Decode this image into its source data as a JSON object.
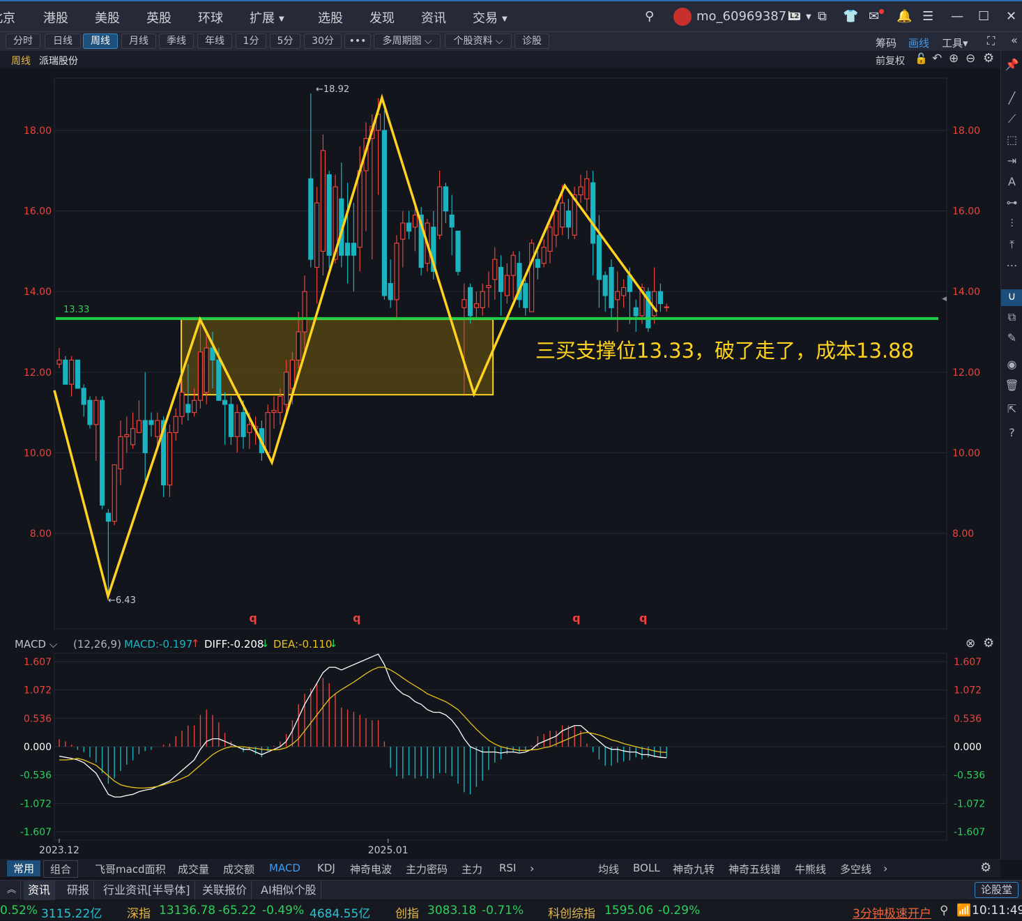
{
  "colors": {
    "up": "#e8453c",
    "down": "#1ab3c0",
    "drawing": "#ffd21f",
    "support": "#22cc44",
    "zone_fill": "#5a4a12",
    "grid": "#262a36"
  },
  "topbar": {
    "nav": [
      {
        "label": "北京"
      },
      {
        "label": "港股"
      },
      {
        "label": "美股"
      },
      {
        "label": "英股"
      },
      {
        "label": "环球"
      },
      {
        "label": "扩展",
        "dropdown": true
      },
      {
        "label": "选股"
      },
      {
        "label": "发现"
      },
      {
        "label": "资讯"
      },
      {
        "label": "交易",
        "dropdown": true
      }
    ],
    "username": "mo_60969387!",
    "level_badge": "L2",
    "icons": [
      "search-icon",
      "avatar",
      "dropdown-icon",
      "external-window-icon",
      "shirt-icon",
      "mail-icon",
      "bell-icon",
      "list-icon",
      "minimize-icon",
      "maximize-icon",
      "close-icon"
    ]
  },
  "toolbar": {
    "periods": [
      "分时",
      "日线",
      "周线",
      "月线",
      "季线",
      "年线",
      "1分",
      "5分",
      "30分",
      "•••",
      "多周期图 ⌵",
      "个股资料 ⌵",
      "诊股"
    ],
    "active": "周线",
    "right": {
      "chips": "筹码",
      "draw": "画线",
      "tools": "工具▾"
    }
  },
  "title": {
    "period": "周线",
    "stock": "派瑞股份",
    "adjust": "前复权"
  },
  "chart_data": [
    {
      "type": "candlestick",
      "title": "派瑞股份",
      "period": "周线",
      "yticks": [
        "18.00",
        "16.00",
        "14.00",
        "12.00",
        "10.00",
        "8.00"
      ],
      "ylim": [
        5.55,
        19.2
      ],
      "xticks": [
        {
          "label": "2023.12",
          "index": 0
        },
        {
          "label": "2025.01",
          "index": 53.6
        }
      ],
      "max_label": "←18.92",
      "min_label": "←6.43",
      "fields": [
        "open",
        "close",
        "high",
        "low"
      ],
      "candles": [
        [
          12.2,
          12.3,
          12.6,
          12.1
        ],
        [
          12.3,
          11.7,
          12.4,
          11.7
        ],
        [
          11.7,
          12.3,
          12.4,
          11.4
        ],
        [
          12.3,
          11.6,
          12.3,
          11.6
        ],
        [
          11.6,
          11.2,
          11.7,
          10.9
        ],
        [
          11.3,
          10.7,
          11.4,
          10.6
        ],
        [
          10.7,
          11.3,
          11.4,
          9.8
        ],
        [
          11.3,
          8.7,
          11.4,
          8.6
        ],
        [
          8.5,
          8.3,
          8.6,
          6.43
        ],
        [
          8.3,
          9.7,
          9.7,
          8.2
        ],
        [
          9.6,
          10.4,
          10.8,
          9.2
        ],
        [
          10.4,
          10.45,
          10.9,
          10.0
        ],
        [
          10.2,
          10.6,
          11.0,
          10.1
        ],
        [
          10.5,
          10.8,
          11.3,
          10.5
        ],
        [
          10.8,
          10.0,
          12.0,
          9.3
        ],
        [
          10.8,
          10.7,
          11.0,
          10.4
        ],
        [
          10.4,
          10.8,
          11.0,
          10.2
        ],
        [
          10.8,
          9.2,
          10.9,
          8.9
        ],
        [
          9.2,
          10.5,
          10.7,
          8.9
        ],
        [
          10.5,
          10.9,
          11.1,
          10.3
        ],
        [
          10.9,
          11.5,
          11.8,
          10.7
        ],
        [
          11.2,
          11.0,
          12.2,
          10.8
        ],
        [
          11.0,
          11.3,
          11.6,
          10.9
        ],
        [
          11.3,
          12.5,
          13.33,
          11.1
        ],
        [
          11.5,
          12.6,
          13.0,
          11.2
        ],
        [
          12.6,
          12.3,
          13.0,
          11.6
        ],
        [
          12.3,
          11.3,
          12.6,
          11.3
        ],
        [
          11.3,
          11.2,
          11.5,
          10.2
        ],
        [
          11.2,
          10.4,
          11.4,
          10.2
        ],
        [
          10.4,
          11.0,
          11.2,
          10.0
        ],
        [
          11.0,
          10.4,
          11.3,
          10.1
        ],
        [
          10.5,
          10.7,
          11.0,
          10.1
        ],
        [
          10.6,
          10.65,
          10.9,
          10.2
        ],
        [
          10.6,
          10.0,
          10.8,
          9.8
        ],
        [
          10.0,
          11.0,
          11.2,
          9.9
        ],
        [
          11.0,
          11.05,
          11.4,
          10.6
        ],
        [
          11.0,
          11.4,
          11.6,
          10.7
        ],
        [
          11.2,
          12.0,
          12.3,
          10.9
        ],
        [
          11.6,
          12.3,
          12.5,
          11.2
        ],
        [
          12.3,
          13.0,
          13.5,
          12.1
        ],
        [
          13.0,
          14.0,
          14.4,
          12.5
        ],
        [
          16.8,
          14.8,
          18.92,
          14.6
        ],
        [
          14.6,
          16.2,
          16.6,
          13.7
        ],
        [
          15.0,
          17.5,
          17.9,
          14.4
        ],
        [
          16.9,
          14.9,
          17.0,
          14.6
        ],
        [
          14.8,
          16.6,
          16.9,
          14.7
        ],
        [
          16.3,
          14.9,
          17.2,
          14.6
        ],
        [
          15.2,
          14.9,
          16.7,
          14.2
        ],
        [
          15.2,
          14.9,
          16.2,
          14.0
        ],
        [
          15.1,
          17.0,
          17.6,
          14.5
        ],
        [
          17.0,
          17.8,
          18.2,
          15.5
        ],
        [
          17.8,
          18.1,
          18.4,
          14.8
        ],
        [
          18.0,
          18.4,
          18.8,
          16.4
        ],
        [
          18.0,
          13.9,
          18.5,
          13.8
        ],
        [
          14.2,
          13.8,
          14.8,
          13.6
        ],
        [
          13.8,
          15.2,
          15.4,
          13.3
        ],
        [
          15.3,
          15.7,
          16.0,
          14.6
        ],
        [
          15.7,
          15.5,
          16.0,
          15.3
        ],
        [
          15.6,
          15.9,
          16.2,
          15.0
        ],
        [
          15.9,
          14.6,
          16.1,
          14.4
        ],
        [
          14.7,
          15.7,
          15.8,
          14.5
        ],
        [
          15.6,
          14.5,
          16.0,
          14.3
        ],
        [
          15.4,
          16.6,
          17.0,
          15.3
        ],
        [
          16.6,
          16.0,
          16.7,
          15.7
        ],
        [
          15.9,
          15.6,
          16.4,
          14.9
        ],
        [
          15.5,
          14.5,
          15.5,
          14.4
        ],
        [
          13.6,
          13.8,
          14.2,
          11.45
        ],
        [
          14.1,
          13.4,
          14.2,
          13.2
        ],
        [
          13.6,
          13.7,
          14.0,
          13.3
        ],
        [
          13.6,
          14.0,
          14.2,
          13.4
        ],
        [
          14.1,
          14.15,
          14.5,
          13.6
        ],
        [
          14.3,
          14.8,
          15.1,
          13.8
        ],
        [
          14.6,
          14.0,
          14.9,
          13.4
        ],
        [
          13.9,
          14.4,
          14.7,
          13.7
        ],
        [
          14.4,
          14.9,
          15.0,
          13.8
        ],
        [
          14.7,
          13.8,
          15.0,
          13.6
        ],
        [
          14.2,
          13.6,
          14.3,
          13.4
        ],
        [
          13.5,
          15.2,
          15.3,
          13.5
        ],
        [
          14.8,
          14.6,
          15.0,
          14.3
        ],
        [
          14.7,
          15.1,
          15.3,
          14.6
        ],
        [
          15.0,
          15.6,
          15.7,
          14.7
        ],
        [
          15.4,
          16.0,
          16.3,
          15.1
        ],
        [
          15.6,
          16.2,
          16.65,
          15.4
        ],
        [
          16.0,
          15.6,
          16.3,
          15.3
        ],
        [
          15.4,
          16.4,
          16.6,
          15.3
        ],
        [
          16.4,
          16.6,
          16.9,
          16.2
        ],
        [
          16.3,
          16.8,
          17.0,
          16.0
        ],
        [
          16.7,
          15.2,
          17.0,
          14.4
        ],
        [
          15.4,
          14.3,
          15.9,
          13.6
        ],
        [
          14.4,
          13.9,
          14.5,
          13.5
        ],
        [
          14.6,
          13.6,
          14.8,
          13.3
        ],
        [
          13.8,
          14.0,
          14.5,
          13.0
        ],
        [
          13.9,
          14.1,
          14.3,
          13.6
        ],
        [
          14.4,
          14.0,
          14.6,
          13.2
        ],
        [
          13.6,
          13.4,
          13.8,
          13.0
        ],
        [
          13.4,
          14.1,
          14.2,
          13.2
        ],
        [
          14.0,
          13.1,
          14.1,
          13.0
        ],
        [
          13.4,
          14.0,
          14.6,
          13.2
        ],
        [
          14.0,
          13.7,
          14.2,
          13.5
        ],
        [
          13.6,
          13.62,
          13.7,
          13.5
        ]
      ],
      "signals": [
        {
          "label": "q",
          "index": 31.6
        },
        {
          "label": "q",
          "index": 48.5
        },
        {
          "label": "q",
          "index": 84.3
        },
        {
          "label": "q",
          "index": 95.2
        }
      ],
      "drawings": {
        "support_line": {
          "price": 13.33,
          "label": "13.33"
        },
        "zigzag": [
          [
            -0.8,
            11.55
          ],
          [
            7.95,
            6.44
          ],
          [
            22.95,
            13.31
          ],
          [
            34.66,
            9.76
          ],
          [
            52.6,
            18.81
          ],
          [
            67.6,
            11.46
          ],
          [
            82.4,
            16.63
          ],
          [
            97.4,
            13.5
          ]
        ],
        "zone": {
          "from_index": 19.9,
          "to_index": 70.7,
          "top": 13.31,
          "bottom": 11.44
        },
        "annotation": "三买支撑位13.33，破了走了，成本13.88"
      }
    },
    {
      "type": "line+bar",
      "title": "MACD",
      "params": "(12,26,9)",
      "readout": {
        "macd": "MACD:-0.197",
        "diff": "DIFF:-0.208",
        "dea": "DEA:-0.110"
      },
      "yticks": [
        "1.607",
        "1.072",
        "0.536",
        "0.000",
        "-0.536",
        "-1.072",
        "-1.607"
      ],
      "ylim": [
        -1.607,
        1.607
      ],
      "diff": [
        -0.18,
        -0.2,
        -0.22,
        -0.25,
        -0.3,
        -0.4,
        -0.5,
        -0.7,
        -0.9,
        -0.95,
        -0.95,
        -0.92,
        -0.9,
        -0.85,
        -0.82,
        -0.8,
        -0.75,
        -0.7,
        -0.65,
        -0.55,
        -0.45,
        -0.35,
        -0.25,
        -0.05,
        0.1,
        0.15,
        0.15,
        0.1,
        0.05,
        0.0,
        -0.05,
        -0.05,
        -0.1,
        -0.15,
        -0.1,
        -0.05,
        0.0,
        0.1,
        0.3,
        0.55,
        0.8,
        1.0,
        1.2,
        1.4,
        1.5,
        1.5,
        1.45,
        1.5,
        1.55,
        1.6,
        1.65,
        1.7,
        1.75,
        1.55,
        1.25,
        1.1,
        1.0,
        0.95,
        0.85,
        0.8,
        0.7,
        0.65,
        0.65,
        0.6,
        0.5,
        0.35,
        0.15,
        0.0,
        -0.05,
        -0.1,
        -0.1,
        -0.1,
        -0.12,
        -0.1,
        -0.1,
        -0.12,
        -0.1,
        -0.05,
        0.05,
        0.1,
        0.15,
        0.2,
        0.3,
        0.35,
        0.4,
        0.4,
        0.3,
        0.2,
        0.1,
        0.0,
        -0.05,
        -0.05,
        -0.08,
        -0.1,
        -0.1,
        -0.15,
        -0.15,
        -0.18,
        -0.2,
        -0.208
      ],
      "dea": [
        -0.25,
        -0.25,
        -0.24,
        -0.22,
        -0.25,
        -0.3,
        -0.35,
        -0.45,
        -0.55,
        -0.65,
        -0.72,
        -0.75,
        -0.77,
        -0.78,
        -0.78,
        -0.77,
        -0.75,
        -0.72,
        -0.68,
        -0.65,
        -0.6,
        -0.55,
        -0.45,
        -0.35,
        -0.25,
        -0.15,
        -0.08,
        -0.03,
        0.0,
        0.0,
        0.0,
        -0.02,
        -0.03,
        -0.05,
        -0.06,
        -0.06,
        -0.05,
        -0.02,
        0.05,
        0.15,
        0.3,
        0.45,
        0.6,
        0.75,
        0.9,
        1.0,
        1.08,
        1.15,
        1.22,
        1.3,
        1.38,
        1.45,
        1.5,
        1.5,
        1.45,
        1.38,
        1.3,
        1.22,
        1.15,
        1.08,
        1.0,
        0.95,
        0.9,
        0.85,
        0.78,
        0.7,
        0.58,
        0.45,
        0.33,
        0.22,
        0.12,
        0.05,
        0.0,
        -0.03,
        -0.05,
        -0.07,
        -0.07,
        -0.06,
        -0.05,
        -0.02,
        0.0,
        0.05,
        0.1,
        0.15,
        0.2,
        0.25,
        0.27,
        0.25,
        0.22,
        0.18,
        0.13,
        0.1,
        0.06,
        0.03,
        0.0,
        -0.03,
        -0.05,
        -0.08,
        -0.1,
        -0.11
      ]
    }
  ],
  "indicator_bar": {
    "groups": [
      "常用",
      "组合"
    ],
    "active_group": "常用",
    "indicators": [
      "飞哥macd面积",
      "成交量",
      "成交额",
      "MACD",
      "KDJ",
      "神奇电波",
      "主力密码",
      "主力",
      "RSI"
    ],
    "active": "MACD",
    "overlays": [
      "均线",
      "BOLL",
      "神奇九转",
      "神奇五线谱",
      "牛熊线",
      "多空线"
    ]
  },
  "news_bar": {
    "tabs": [
      "资讯",
      "研报",
      "行业资讯[半导体]",
      "关联报价",
      "AI相似个股"
    ],
    "active": "资讯",
    "forum": "论股堂"
  },
  "ticker": {
    "sh_pct": "0.52%",
    "sh_amount": "3115.22亿",
    "sz_name": "深指",
    "sz_value": "13136.78",
    "sz_change": "-65.22",
    "sz_pct": "-0.49%",
    "sz_amount": "4684.55亿",
    "cy_name": "创指",
    "cy_value": "3083.18",
    "cy_pct": "-0.71%",
    "kc_name": "科创综指",
    "kc_value": "1595.06",
    "kc_pct": "-0.29%",
    "open_account": "3分钟极速开户",
    "time": "10:11:49"
  }
}
